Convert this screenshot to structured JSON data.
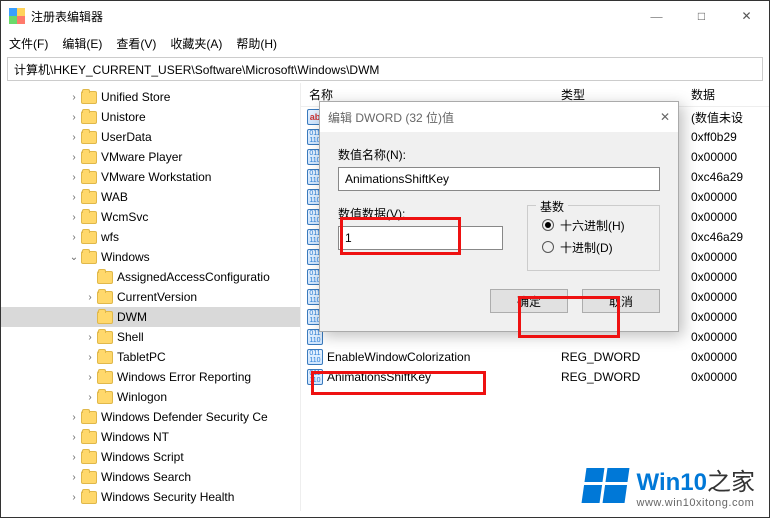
{
  "title": "注册表编辑器",
  "win_controls": {
    "min": "—",
    "max": "□",
    "close": "✕"
  },
  "menu": [
    "文件(F)",
    "编辑(E)",
    "查看(V)",
    "收藏夹(A)",
    "帮助(H)"
  ],
  "address": "计算机\\HKEY_CURRENT_USER\\Software\\Microsoft\\Windows\\DWM",
  "tree": [
    {
      "indent": 66,
      "chev": ">",
      "label": "Unified Store"
    },
    {
      "indent": 66,
      "chev": ">",
      "label": "Unistore"
    },
    {
      "indent": 66,
      "chev": ">",
      "label": "UserData"
    },
    {
      "indent": 66,
      "chev": ">",
      "label": "VMware Player"
    },
    {
      "indent": 66,
      "chev": ">",
      "label": "VMware Workstation"
    },
    {
      "indent": 66,
      "chev": ">",
      "label": "WAB"
    },
    {
      "indent": 66,
      "chev": ">",
      "label": "WcmSvc"
    },
    {
      "indent": 66,
      "chev": ">",
      "label": "wfs"
    },
    {
      "indent": 66,
      "chev": "v",
      "label": "Windows"
    },
    {
      "indent": 82,
      "chev": "",
      "label": "AssignedAccessConfiguratio"
    },
    {
      "indent": 82,
      "chev": ">",
      "label": "CurrentVersion"
    },
    {
      "indent": 82,
      "chev": "",
      "label": "DWM",
      "selected": true
    },
    {
      "indent": 82,
      "chev": ">",
      "label": "Shell"
    },
    {
      "indent": 82,
      "chev": ">",
      "label": "TabletPC"
    },
    {
      "indent": 82,
      "chev": ">",
      "label": "Windows Error Reporting"
    },
    {
      "indent": 82,
      "chev": ">",
      "label": "Winlogon"
    },
    {
      "indent": 66,
      "chev": ">",
      "label": "Windows Defender Security Ce"
    },
    {
      "indent": 66,
      "chev": ">",
      "label": "Windows NT"
    },
    {
      "indent": 66,
      "chev": ">",
      "label": "Windows Script"
    },
    {
      "indent": 66,
      "chev": ">",
      "label": "Windows Search"
    },
    {
      "indent": 66,
      "chev": ">",
      "label": "Windows Security Health"
    }
  ],
  "list_headers": {
    "c1": "名称",
    "c2": "类型",
    "c3": "数据"
  },
  "list": [
    {
      "icon": "str",
      "name": "",
      "type": "",
      "data": "(数值未设"
    },
    {
      "icon": "dw",
      "name": "",
      "type": "",
      "data": "0xff0b29"
    },
    {
      "icon": "dw",
      "name": "",
      "type": "",
      "data": "0x00000"
    },
    {
      "icon": "dw",
      "name": "",
      "type": "",
      "data": "0xc46a29"
    },
    {
      "icon": "dw",
      "name": "",
      "type": "",
      "data": "0x00000"
    },
    {
      "icon": "dw",
      "name": "",
      "type": "",
      "data": "0x00000"
    },
    {
      "icon": "dw",
      "name": "",
      "type": "",
      "data": "0xc46a29"
    },
    {
      "icon": "dw",
      "name": "",
      "type": "",
      "data": "0x00000"
    },
    {
      "icon": "dw",
      "name": "",
      "type": "",
      "data": "0x00000"
    },
    {
      "icon": "dw",
      "name": "",
      "type": "",
      "data": "0x00000"
    },
    {
      "icon": "dw",
      "name": "",
      "type": "",
      "data": "0x00000"
    },
    {
      "icon": "dw",
      "name": "",
      "type": "",
      "data": "0x00000"
    },
    {
      "icon": "dw",
      "name": "EnableWindowColorization",
      "type": "REG_DWORD",
      "data": "0x00000"
    },
    {
      "icon": "dw",
      "name": "AnimationsShiftKey",
      "type": "REG_DWORD",
      "data": "0x00000"
    }
  ],
  "dialog": {
    "title": "编辑 DWORD (32 位)值",
    "close": "✕",
    "name_label": "数值名称(N):",
    "name_value": "AnimationsShiftKey",
    "data_label": "数值数据(V):",
    "data_value": "1",
    "radix_caption": "基数",
    "hex": "十六进制(H)",
    "dec": "十进制(D)",
    "ok": "确定",
    "cancel": "取消"
  },
  "watermark": {
    "brand_a": "Win",
    "brand_b": "10",
    "brand_c": "之家",
    "url": "www.win10xitong.com"
  }
}
